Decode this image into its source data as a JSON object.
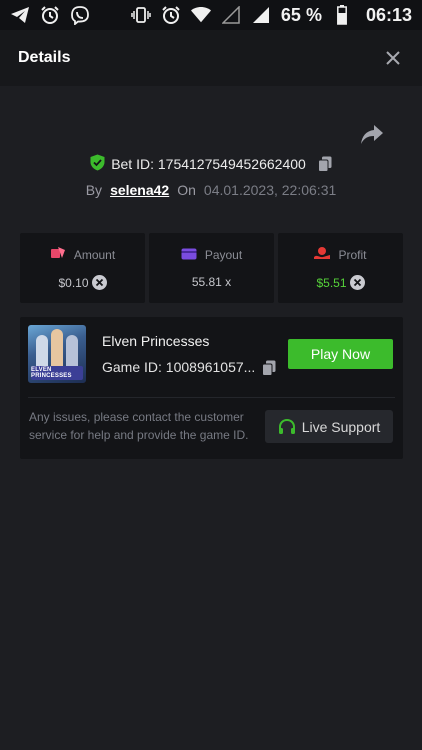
{
  "status_bar": {
    "left_icons": [
      "telegram-icon",
      "alarm-icon",
      "viber-icon"
    ],
    "right_icons": [
      "vibrate-icon",
      "alarm-icon",
      "wifi-icon",
      "signal-icon",
      "signal-icon",
      "battery-icon"
    ],
    "battery": "65 %",
    "time": "06:13"
  },
  "header": {
    "title": "Details"
  },
  "bet": {
    "bet_id": "Bet ID: 1754127549452662400",
    "by_label": "By",
    "username": "selena42",
    "on_label": "On",
    "date": "04.01.2023, 22:06:31"
  },
  "stats": [
    {
      "label": "Amount",
      "value": "$0.10",
      "icon": "amount-icon",
      "color": "#e8476a",
      "has_badge": true
    },
    {
      "label": "Payout",
      "value": "55.81 x",
      "icon": "payout-icon",
      "color": "#7a4ce0",
      "has_badge": false
    },
    {
      "label": "Profit",
      "value": "$5.51",
      "icon": "profit-icon",
      "color": "#e53935",
      "has_badge": true
    }
  ],
  "game": {
    "name": "Elven Princesses",
    "game_id": "Game ID: 1008961057...",
    "thumb_label": "ELVEN PRINCESSES",
    "play_label": "Play Now",
    "support_text": "Any issues, please contact the customer service for help and provide the game ID.",
    "support_label": "Live Support"
  },
  "colors": {
    "accent_green": "#3cbb2c",
    "profit_green": "#56d23a",
    "shield_green": "#3cbb2c"
  }
}
